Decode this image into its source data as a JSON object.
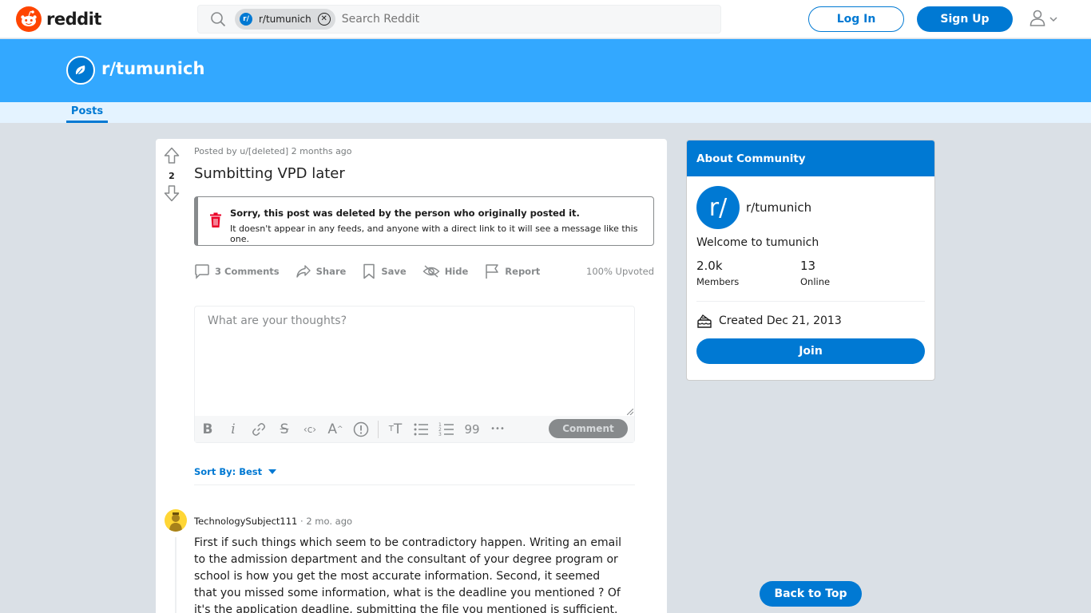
{
  "header": {
    "logo_text": "reddit",
    "search_chip": "r/tumunich",
    "search_chip_avatar": "r/",
    "search_placeholder": "Search Reddit",
    "login_label": "Log In",
    "signup_label": "Sign Up",
    "icons": [
      "reddit-logo-icon",
      "search-icon",
      "close-circle-icon",
      "user-icon",
      "chevron-down-icon"
    ]
  },
  "banner": {
    "subreddit": "r/tumunich",
    "nav_tab": "Posts",
    "color": "#33a8ff"
  },
  "post": {
    "votes": "2",
    "meta": "Posted by u/[deleted] 2 months ago",
    "title": "Sumbitting VPD later",
    "deleted_title": "Sorry, this post was deleted by the person who originally posted it.",
    "deleted_sub": "It doesn't appear in any feeds, and anyone with a direct link to it will see a message like this one.",
    "actions": {
      "comments": "3 Comments",
      "share": "Share",
      "save": "Save",
      "hide": "Hide",
      "report": "Report"
    },
    "upvoted": "100% Upvoted"
  },
  "editor": {
    "placeholder": "What are your thoughts?",
    "comment_button": "Comment",
    "toolbar_quote_glyph": "99",
    "toolbar_more_glyph": "•••"
  },
  "sort": {
    "label": "Sort By: Best"
  },
  "comment": {
    "author": "TechnologySubject111",
    "time": " · 2 mo. ago",
    "body": "First if such things which seem to be contradictory happen. Writing an email to the admission department and the consultant of your degree program or school is how you get the most accurate information. Second, it seemed that you missed some information, what is the deadline you mentioned ?  Of it's the application deadline, submitting the file you mentioned is sufficient. If it's not maybe you"
  },
  "about": {
    "header": "About Community",
    "avatar": "r/",
    "name": "r/tumunich",
    "description": "Welcome to tumunich",
    "members_value": "2.0k",
    "members_label": "Members",
    "online_value": "13",
    "online_label": "Online",
    "created": "Created Dec 21, 2013",
    "join_label": "Join"
  },
  "back_to_top": "Back to Top",
  "colors": {
    "accent": "#0079d3",
    "brand": "#ff4500",
    "background": "#dae0e6"
  }
}
